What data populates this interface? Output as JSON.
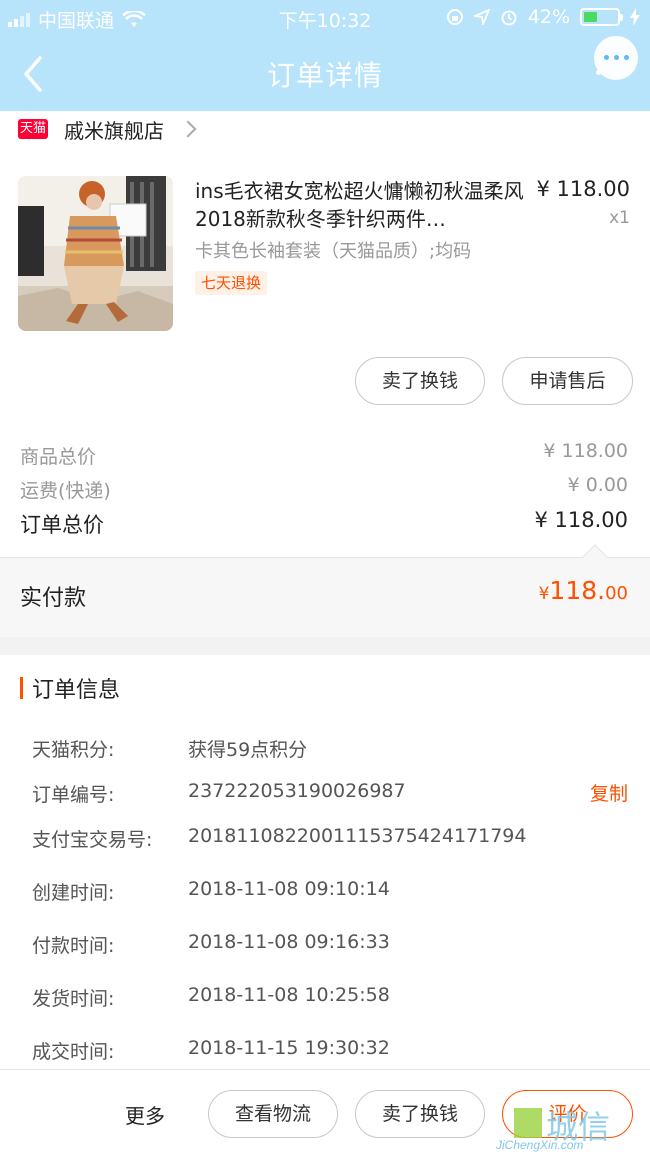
{
  "status_bar": {
    "carrier": "中国联通",
    "time": "下午10:32",
    "battery": "42%",
    "battery_level": 0.42
  },
  "nav": {
    "title": "订单详情"
  },
  "store": {
    "badge": "天猫",
    "name": "戚米旗舰店"
  },
  "product": {
    "title": "ins毛衣裙女宽松超火慵懒初秋温柔风2018新款秋冬季针织两件…",
    "price": "¥ 118.00",
    "qty": "x1",
    "sku": "卡其色长袖套装（天猫品质）;均码",
    "tag": "七天退换"
  },
  "item_actions": {
    "sell": "卖了换钱",
    "after_sale": "申请售后"
  },
  "totals": {
    "goods_label": "商品总价",
    "goods_value": "¥ 118.00",
    "shipping_label": "运费(快递)",
    "shipping_value": "¥ 0.00",
    "order_label": "订单总价",
    "order_value": "¥ 118.00"
  },
  "paid": {
    "label": "实付款",
    "currency": "¥",
    "integer": "118.",
    "decimal": "00"
  },
  "order_info": {
    "title": "订单信息",
    "copy": "复制",
    "rows": [
      {
        "label": "天猫积分:",
        "value": "获得59点积分"
      },
      {
        "label": "订单编号:",
        "value": "237222053190026987"
      },
      {
        "label": "支付宝交易号:",
        "value": "2018110822001115375424171794"
      },
      {
        "label": "创建时间:",
        "value": "2018-11-08 09:10:14"
      },
      {
        "label": "付款时间:",
        "value": "2018-11-08 09:16:33"
      },
      {
        "label": "发货时间:",
        "value": "2018-11-08 10:25:58"
      },
      {
        "label": "成交时间:",
        "value": "2018-11-15 19:30:32"
      }
    ]
  },
  "bottom_bar": {
    "more": "更多",
    "logistics": "查看物流",
    "sell": "卖了换钱",
    "review": "评价"
  },
  "watermark": {
    "text": "城信",
    "url": "JiChengXin.com"
  },
  "colors": {
    "header": "#b7e3fb",
    "accent": "#ff5000",
    "tmall": "#ff0036"
  }
}
